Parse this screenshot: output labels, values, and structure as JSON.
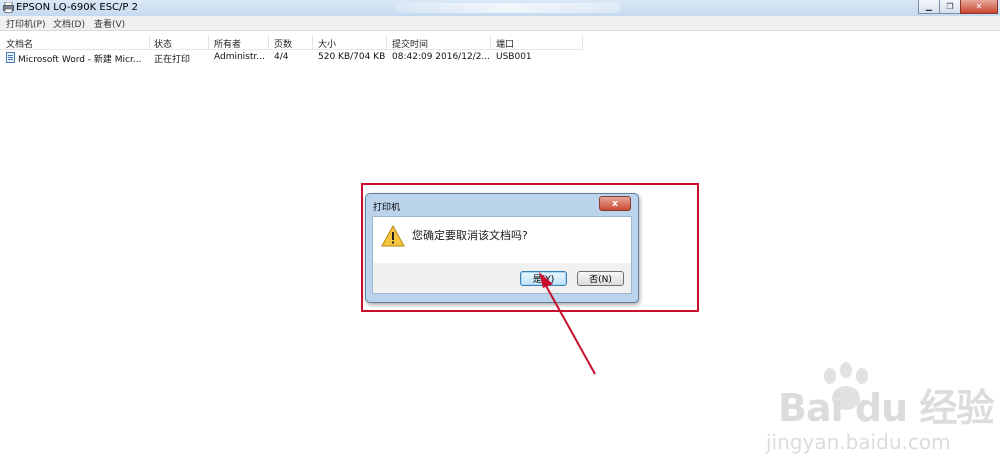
{
  "window": {
    "title": "EPSON LQ-690K ESC/P 2",
    "controls": [
      "minimize-icon",
      "restore-icon",
      "close-icon"
    ]
  },
  "menu": {
    "items": [
      {
        "label": "打印机(P)"
      },
      {
        "label": "文档(D)"
      },
      {
        "label": "查看(V)"
      }
    ]
  },
  "table": {
    "columns": [
      "文档名",
      "状态",
      "所有者",
      "页数",
      "大小",
      "提交时间",
      "端口"
    ],
    "rows": [
      [
        "Microsoft Word - 新建 Micr...",
        "正在打印",
        "Administr...",
        "4/4",
        "520 KB/704 KB",
        "08:42:09   2016/12/2...",
        "USB001"
      ]
    ]
  },
  "dialog": {
    "title": "打印机",
    "message": "您确定要取消该文档吗?",
    "close_glyph": "x",
    "icon": "warning-icon",
    "buttons": {
      "yes": "是(Y)",
      "no": "否(N)"
    }
  },
  "annotation": {
    "box_color": "#c8102e",
    "arrow_color": "#c8102e"
  },
  "watermark": {
    "brand": "Bai du 经验",
    "url": "jingyan.baidu.com"
  }
}
